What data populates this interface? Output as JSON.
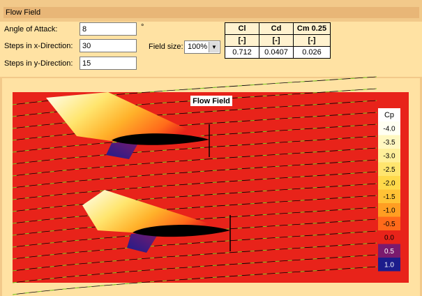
{
  "header": {
    "title": "Flow Field"
  },
  "inputs": {
    "angle": {
      "label": "Angle of Attack:",
      "value": "8",
      "unit": "°"
    },
    "steps_x": {
      "label": "Steps in x-Direction:",
      "value": "30"
    },
    "steps_y": {
      "label": "Steps in y-Direction:",
      "value": "15"
    },
    "field_size": {
      "label": "Field size:",
      "value": "100%"
    }
  },
  "coefficients": {
    "headers": [
      "Cl",
      "Cd",
      "Cm 0.25"
    ],
    "units": [
      "[-]",
      "[-]",
      "[-]"
    ],
    "values": [
      "0.712",
      "0.0407",
      "0.026"
    ]
  },
  "plot": {
    "title": "Flow Field",
    "legend_title": "Cp",
    "legend": [
      {
        "label": "-4.0",
        "color": "#fffff2"
      },
      {
        "label": "-3.5",
        "color": "#fff7c0"
      },
      {
        "label": "-3.0",
        "color": "#ffef9a"
      },
      {
        "label": "-2.5",
        "color": "#ffe56e"
      },
      {
        "label": "-2.0",
        "color": "#ffd94a"
      },
      {
        "label": "-1.5",
        "color": "#ffc235"
      },
      {
        "label": "-1.0",
        "color": "#ff9e22"
      },
      {
        "label": "-0.5",
        "color": "#ff6a1a"
      },
      {
        "label": "0.0",
        "color": "#e8231a"
      },
      {
        "label": "0.5",
        "color": "#7a1a6e"
      },
      {
        "label": "1.0",
        "color": "#1c1c8c"
      }
    ]
  }
}
